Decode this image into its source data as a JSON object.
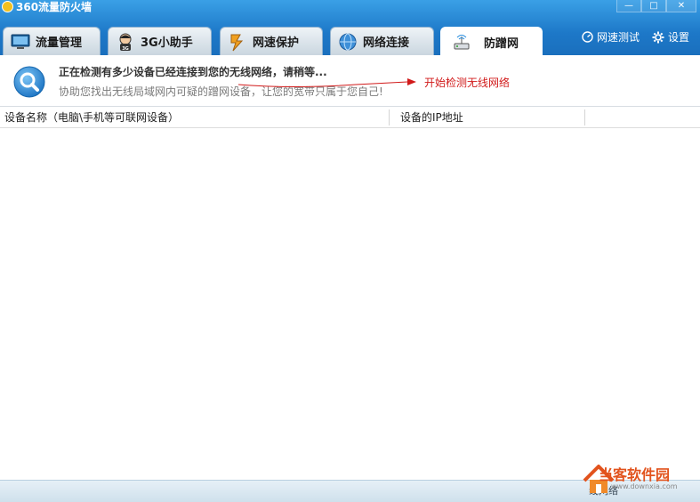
{
  "app": {
    "title": "360流量防火墙"
  },
  "window_controls": {
    "minimize": "—",
    "maximize": "□",
    "close": "✕"
  },
  "tabs": [
    {
      "label": "流量管理",
      "icon": "monitor-icon"
    },
    {
      "label": "3G小助手",
      "icon": "assistant-icon"
    },
    {
      "label": "网速保护",
      "icon": "lightning-shield-icon"
    },
    {
      "label": "网络连接",
      "icon": "globe-icon"
    },
    {
      "label": "防蹭网",
      "icon": "wireless-router-icon",
      "active": true
    }
  ],
  "tools": {
    "speed_test": "网速测试",
    "settings": "设置"
  },
  "banner": {
    "status": "正在检测有多少设备已经连接到您的无线网络，请稍等...",
    "description": "协助您找出无线局域网内可疑的蹭网设备，让您的宽带只属于您自己!",
    "annotation": "开始检测无线网络"
  },
  "table": {
    "columns": [
      "设备名称（电脑\\手机等可联网设备）",
      "设备的IP地址"
    ],
    "rows": []
  },
  "status_bar": {
    "text": "线网络"
  },
  "watermark": {
    "text": "当客软件园",
    "url": "www.downxia.com"
  },
  "colors": {
    "title_bar": "#1d78c8",
    "accent": "#2b8fe0",
    "annotation": "#d11a1a",
    "watermark": "#e2531d"
  }
}
